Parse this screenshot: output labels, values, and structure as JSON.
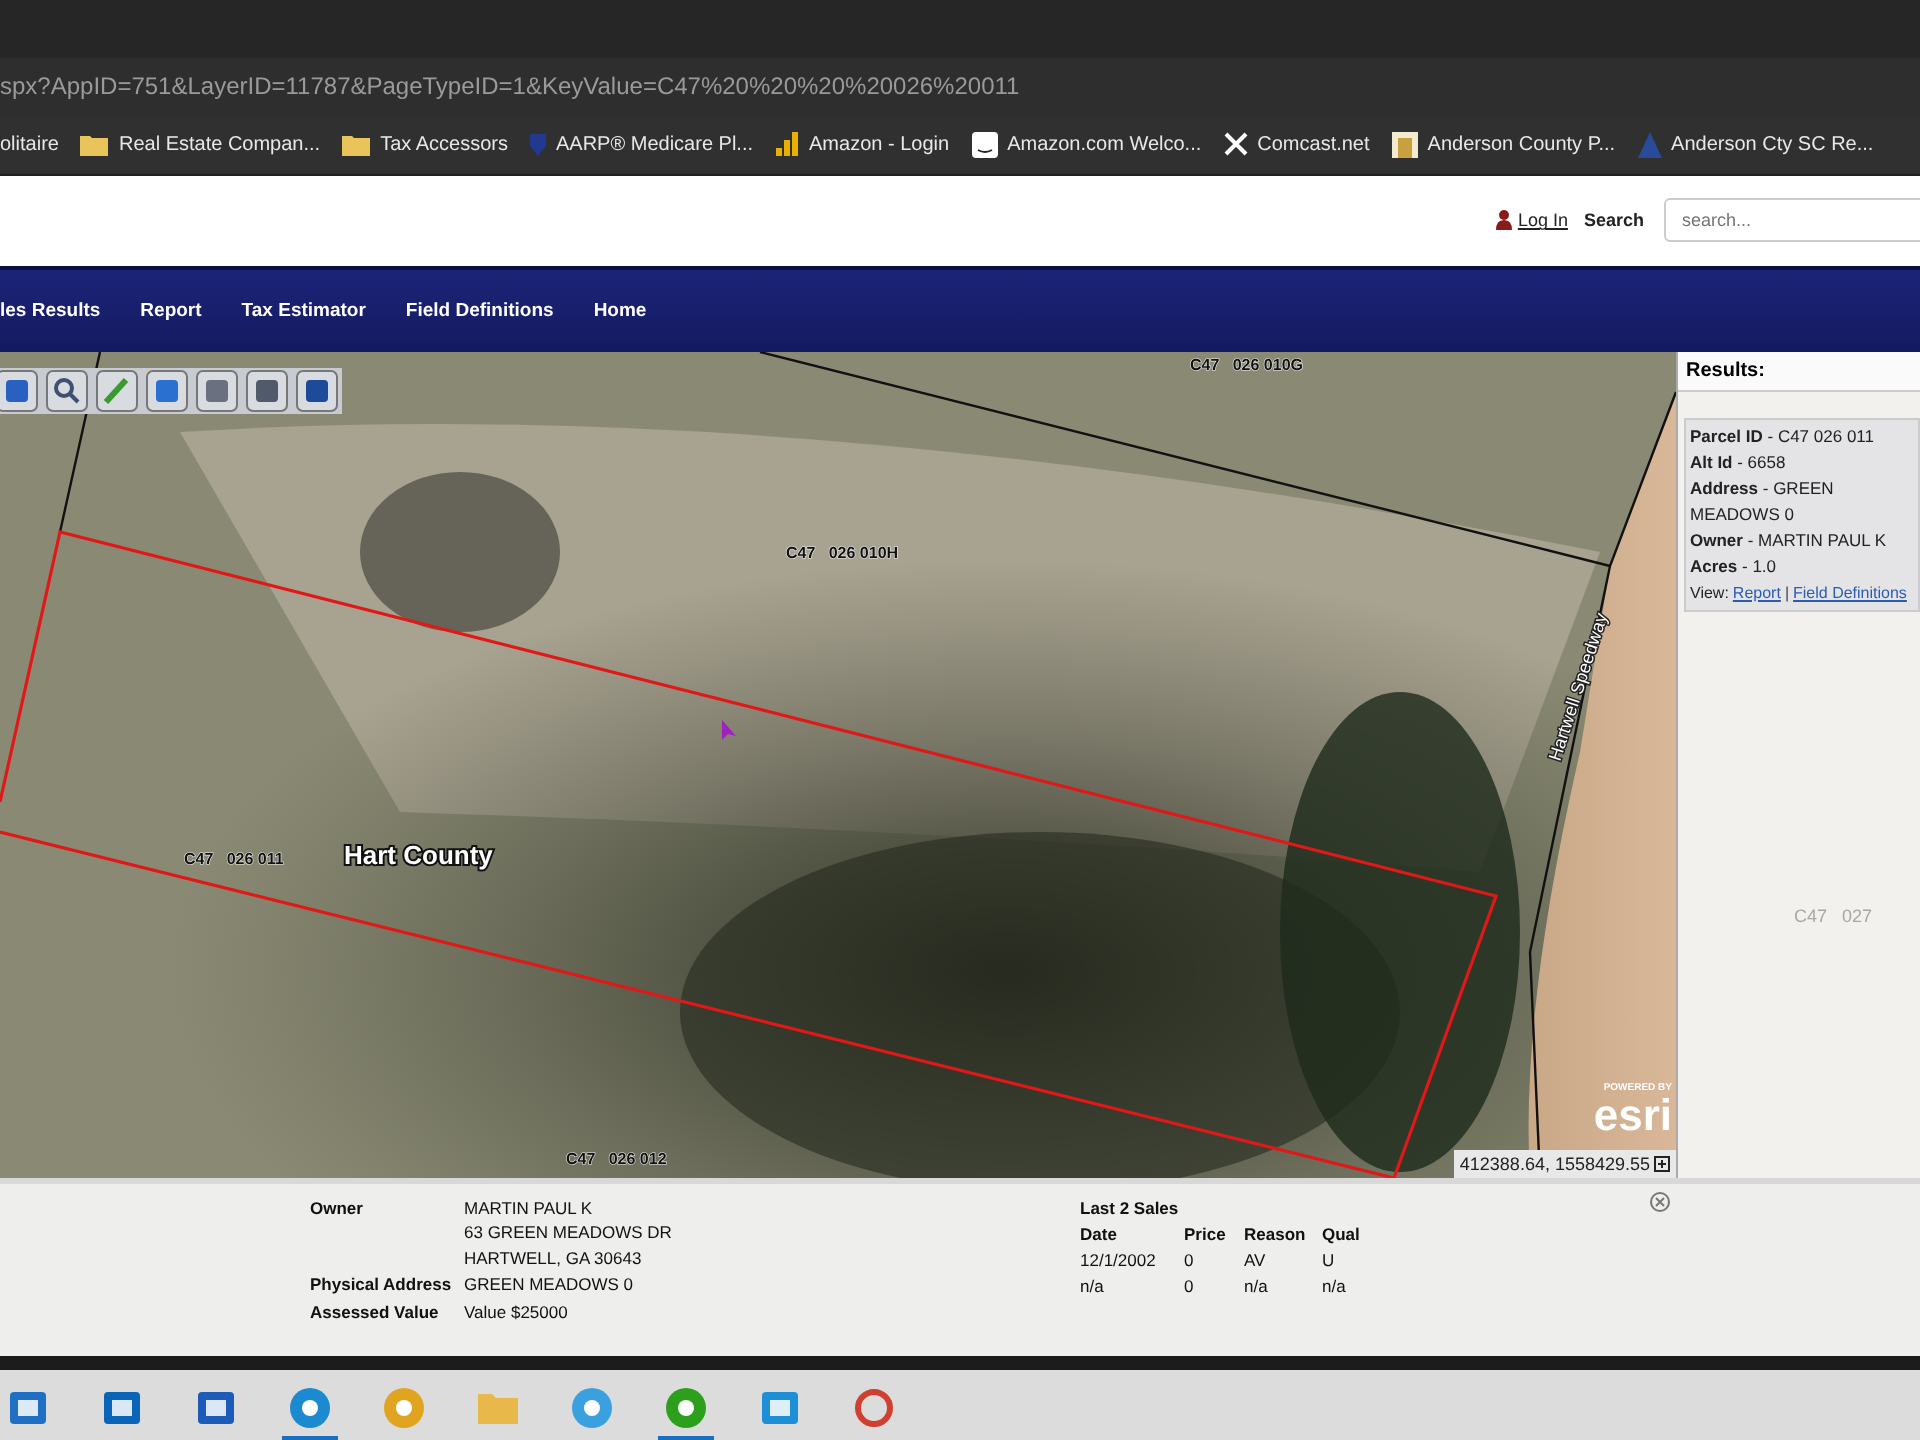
{
  "browser": {
    "url": "spx?AppID=751&LayerID=11787&PageTypeID=1&KeyValue=C47%20%20%20%20026%20011",
    "bookmarks": [
      {
        "kind": "none",
        "label": "olitaire"
      },
      {
        "kind": "folder",
        "label": "Real Estate Compan..."
      },
      {
        "kind": "folder",
        "label": "Tax Accessors"
      },
      {
        "kind": "shield",
        "label": "AARP® Medicare Pl..."
      },
      {
        "kind": "bars",
        "label": "Amazon - Login"
      },
      {
        "kind": "square",
        "label": "Amazon.com Welco..."
      },
      {
        "kind": "x",
        "label": "Comcast.net"
      },
      {
        "kind": "building",
        "label": "Anderson County P..."
      },
      {
        "kind": "letter",
        "label": "Anderson Cty SC Re..."
      }
    ]
  },
  "header": {
    "login": "Log In",
    "search_label": "Search",
    "search_placeholder": "search..."
  },
  "nav": [
    "les Results",
    "Report",
    "Tax Estimator",
    "Field Definitions",
    "Home"
  ],
  "toolbar": [
    {
      "kind": "identify"
    },
    {
      "kind": "zoom"
    },
    {
      "kind": "draw"
    },
    {
      "kind": "extent"
    },
    {
      "kind": "layers"
    },
    {
      "kind": "print"
    },
    {
      "kind": "save"
    }
  ],
  "map": {
    "labels": [
      {
        "kind": "parcel",
        "text": "C47   026 010G"
      },
      {
        "kind": "parcel",
        "text": "C47   026 010H"
      },
      {
        "kind": "parcel",
        "text": "C47   026 011"
      },
      {
        "kind": "county",
        "text": "Hart County"
      },
      {
        "kind": "parcel",
        "text": "C47   026 012"
      },
      {
        "kind": "road",
        "text": "Hartwell Speedway"
      }
    ],
    "attribution_small": "POWERED BY",
    "attribution": "esri",
    "coordinates": "412388.64, 1558429.55"
  },
  "results": {
    "title": "Results:",
    "fields": [
      "**Parcel ID** - C47 026 011",
      "**Alt Id** - 6658",
      "**Address** - GREEN MEADOWS 0",
      "**Owner** - MARTIN PAUL K",
      "**Acres** - 1.0"
    ],
    "view_label": "View:",
    "links": [
      "Report",
      "Field Definitions"
    ],
    "link_separator": "|",
    "behind_label": "C47   027"
  },
  "info": {
    "rows": [
      {
        "label": "Owner",
        "lines": [
          "MARTIN PAUL K",
          "63 GREEN MEADOWS DR",
          "HARTWELL, GA 30643"
        ]
      },
      {
        "label": "Physical Address",
        "lines": [
          "GREEN MEADOWS 0"
        ]
      },
      {
        "label": "Assessed Value",
        "lines": [
          "Value $25000"
        ]
      }
    ],
    "sales_title": "Last 2 Sales",
    "sales_columns": [
      "Date",
      "Price",
      "Reason",
      "Qual"
    ],
    "sales_rows": [
      [
        "12/1/2002",
        "0",
        "AV",
        "U"
      ],
      [
        "n/a",
        "0",
        "n/a",
        "n/a"
      ]
    ]
  },
  "taskbar": [
    {
      "kind": "store",
      "active": false
    },
    {
      "kind": "mail",
      "active": false
    },
    {
      "kind": "doc",
      "active": false
    },
    {
      "kind": "edge",
      "active": true
    },
    {
      "kind": "chrome",
      "active": false
    },
    {
      "kind": "folder",
      "active": false
    },
    {
      "kind": "ie",
      "active": false
    },
    {
      "kind": "qb",
      "active": true
    },
    {
      "kind": "screen",
      "active": false
    },
    {
      "kind": "tool",
      "active": false
    }
  ]
}
